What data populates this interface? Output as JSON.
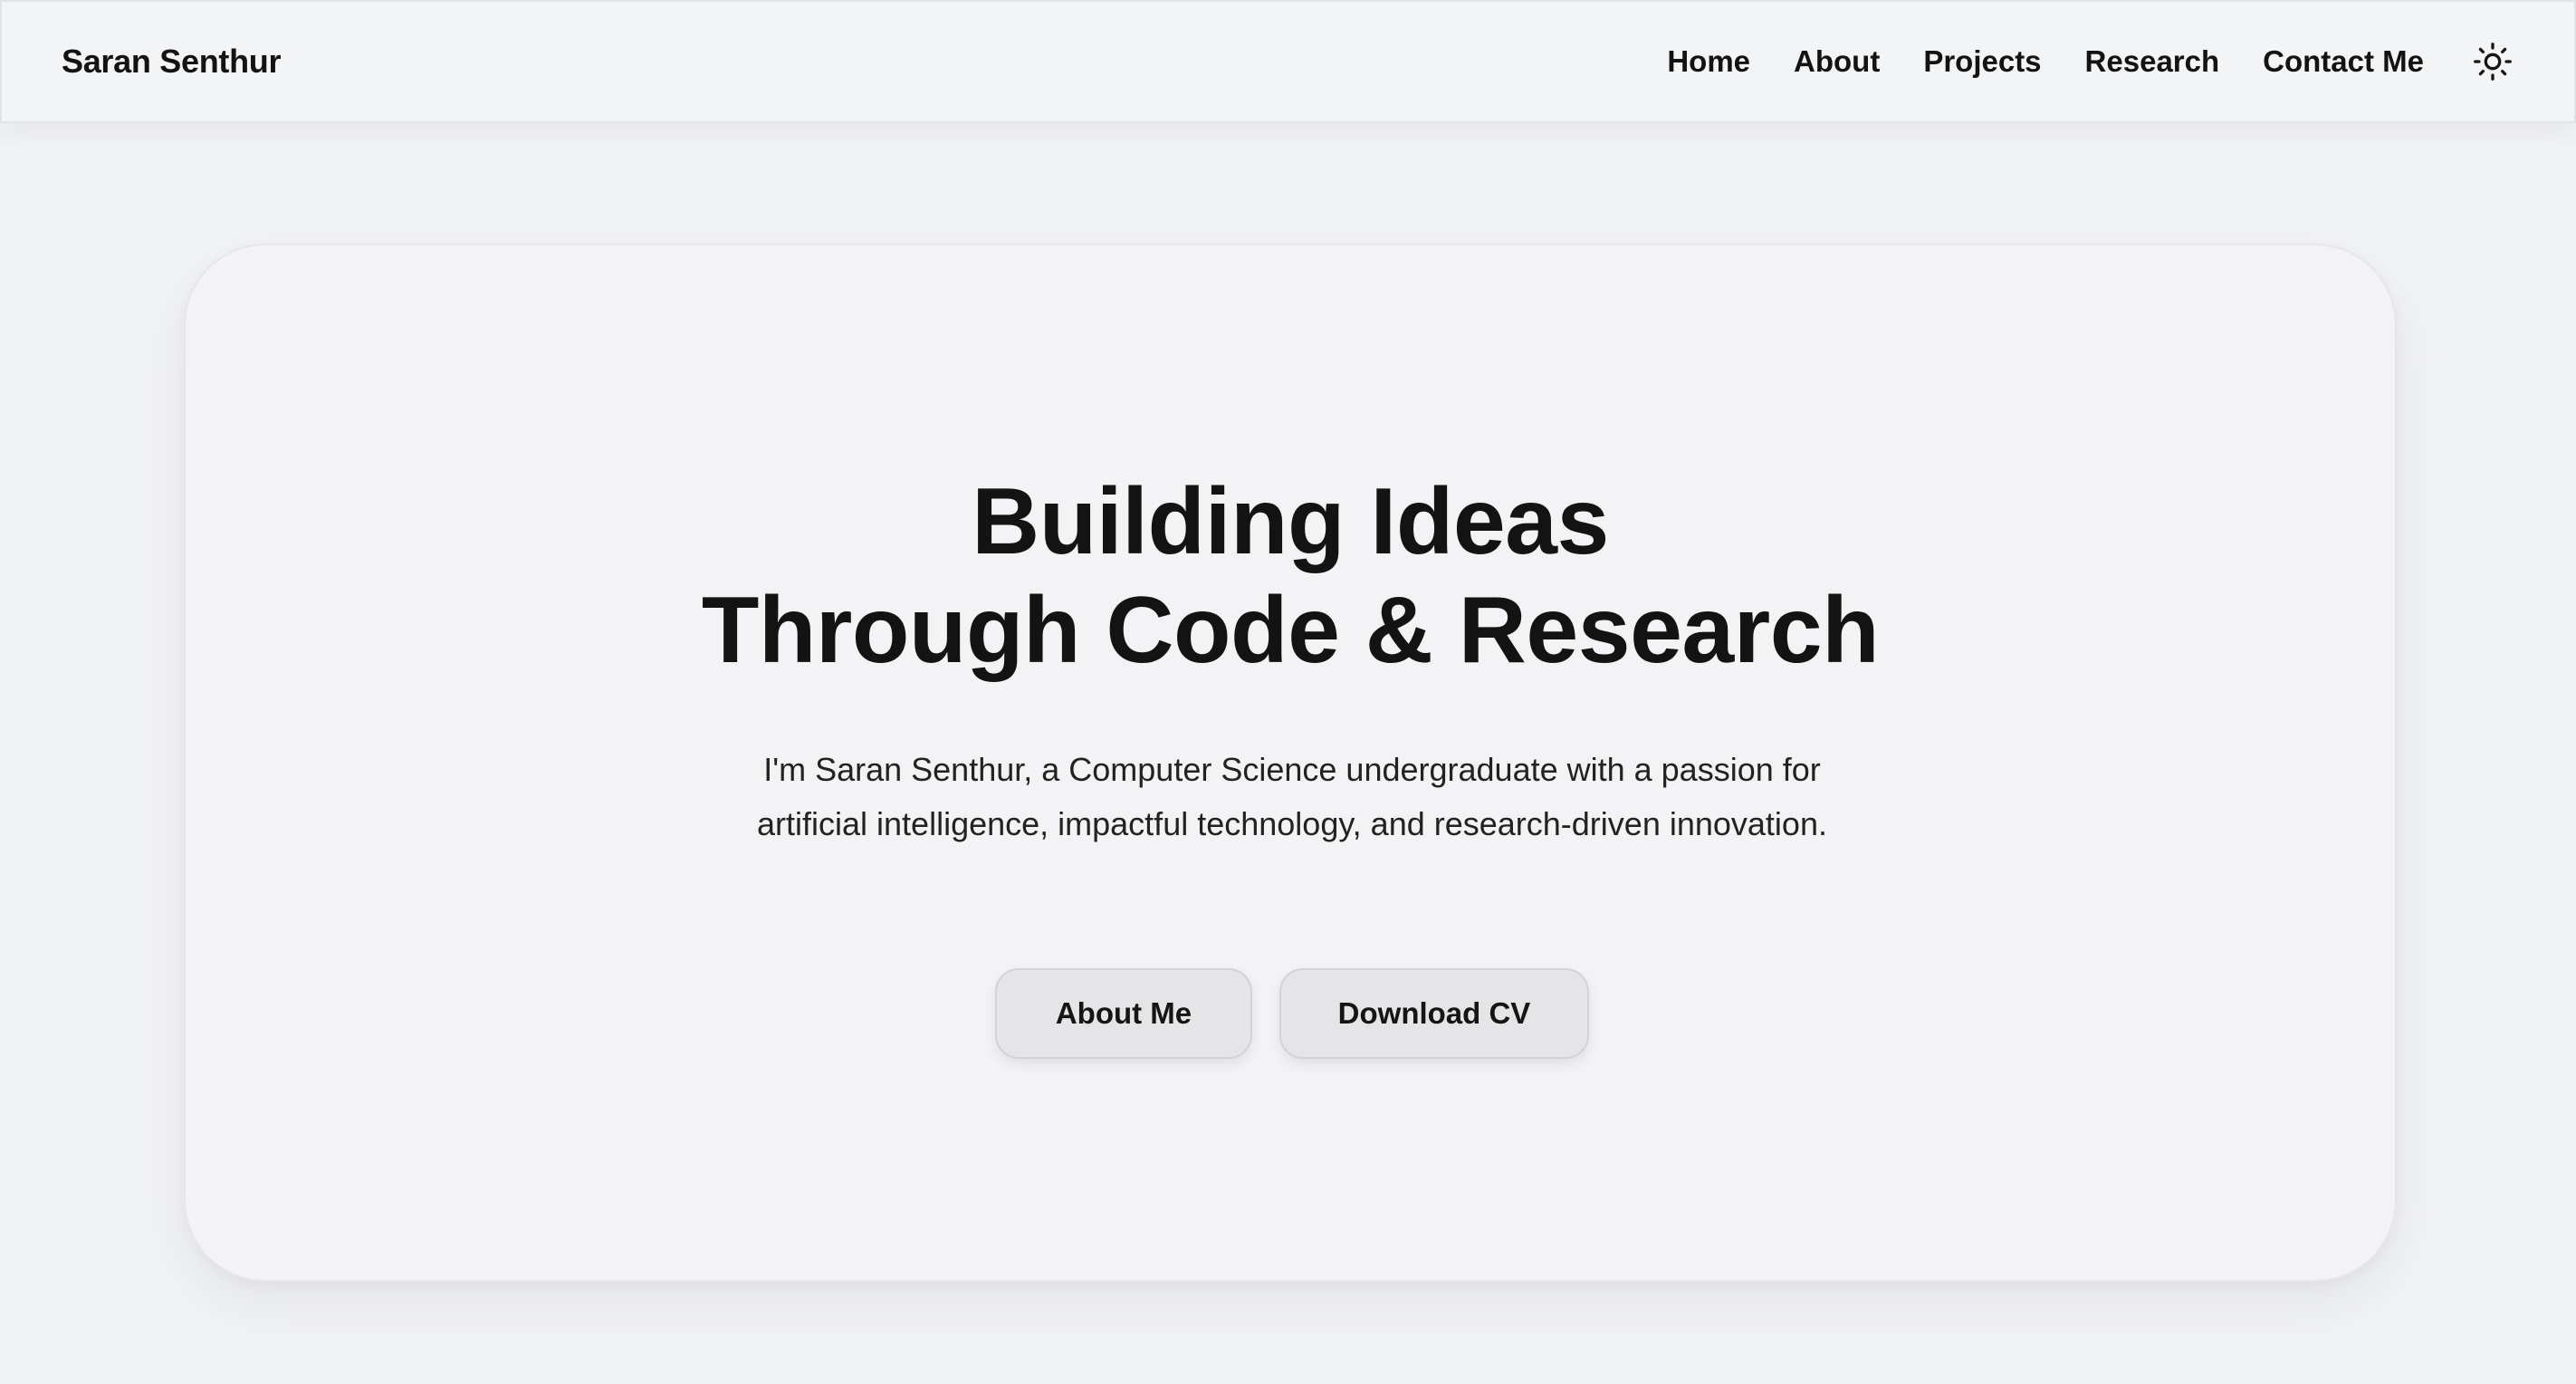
{
  "header": {
    "brand": "Saran Senthur",
    "nav": [
      {
        "label": "Home"
      },
      {
        "label": "About"
      },
      {
        "label": "Projects"
      },
      {
        "label": "Research"
      },
      {
        "label": "Contact Me"
      }
    ],
    "theme_toggle_icon": "sun-icon"
  },
  "hero": {
    "title_line1": "Building Ideas",
    "title_line2": "Through Code & Research",
    "description": "I'm Saran Senthur, a Computer Science undergraduate with a passion for artificial intelligence, impactful technology, and research-driven innovation.",
    "buttons": {
      "about_label": "About Me",
      "cv_label": "Download CV"
    }
  },
  "colors": {
    "background": "#f1f2f4",
    "card": "#f3f3f5",
    "text": "#131313",
    "button": "#e5e5e7"
  }
}
